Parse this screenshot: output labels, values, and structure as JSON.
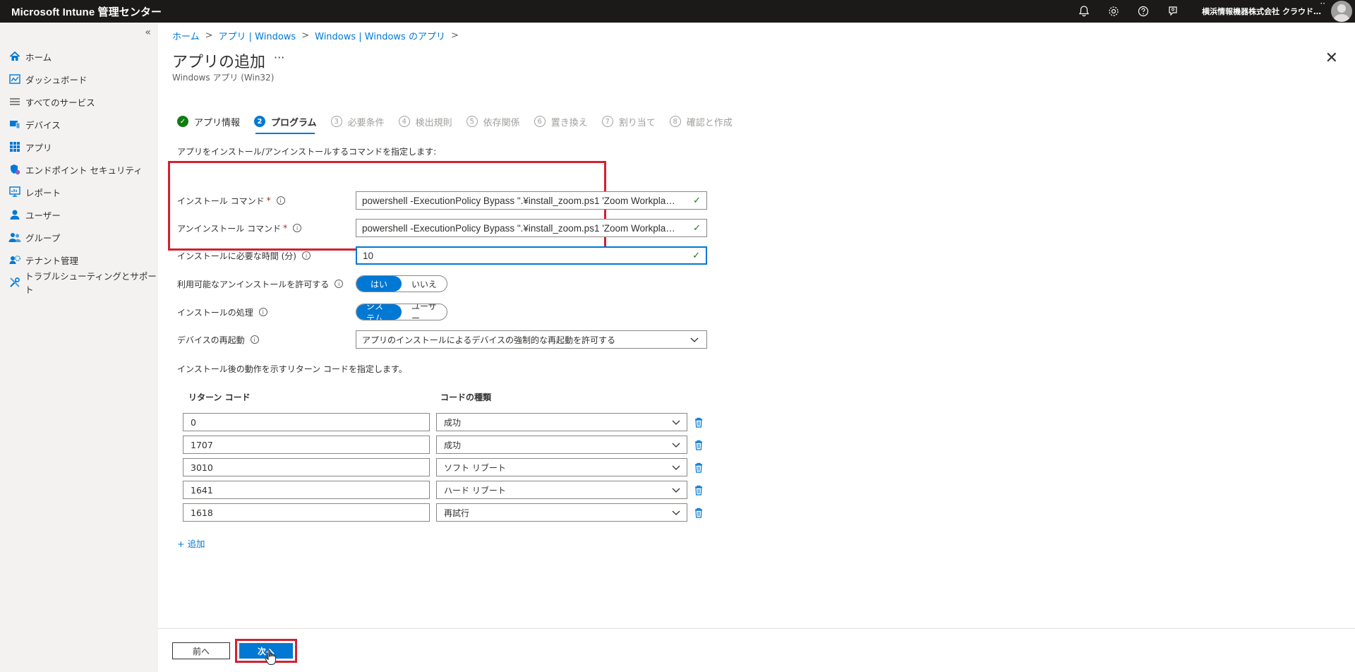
{
  "topbar": {
    "brand": "Microsoft Intune 管理センター",
    "tenant": "横浜情報機器株式会社 クラウド…",
    "dots": "··",
    "icons": [
      "bell-icon",
      "gear-icon",
      "help-icon",
      "feedback-icon"
    ]
  },
  "sidebar": {
    "collapse": "«",
    "items": [
      {
        "label": "ホーム",
        "icon": "home-icon"
      },
      {
        "label": "ダッシュボード",
        "icon": "dashboard-icon"
      },
      {
        "label": "すべてのサービス",
        "icon": "list-icon"
      },
      {
        "label": "デバイス",
        "icon": "devices-icon"
      },
      {
        "label": "アプリ",
        "icon": "apps-icon"
      },
      {
        "label": "エンドポイント セキュリティ",
        "icon": "endpoint-security-icon"
      },
      {
        "label": "レポート",
        "icon": "reports-icon"
      },
      {
        "label": "ユーザー",
        "icon": "user-icon"
      },
      {
        "label": "グループ",
        "icon": "group-icon"
      },
      {
        "label": "テナント管理",
        "icon": "tenant-admin-icon"
      },
      {
        "label": "トラブルシューティングとサポート",
        "icon": "troubleshoot-icon"
      }
    ]
  },
  "breadcrumb": [
    "ホーム",
    "アプリ | Windows",
    "Windows | Windows のアプリ"
  ],
  "breadcrumb_sep": ">",
  "page": {
    "title": "アプリの追加",
    "more": "···",
    "subtitle": "Windows アプリ (Win32)",
    "close": "✕"
  },
  "wizard": {
    "steps": [
      {
        "num": "✓",
        "label": "アプリ情報",
        "state": "done"
      },
      {
        "num": "2",
        "label": "プログラム",
        "state": "active"
      },
      {
        "num": "3",
        "label": "必要条件",
        "state": "pending"
      },
      {
        "num": "4",
        "label": "検出規則",
        "state": "pending"
      },
      {
        "num": "5",
        "label": "依存関係",
        "state": "pending"
      },
      {
        "num": "6",
        "label": "置き換え",
        "state": "pending"
      },
      {
        "num": "7",
        "label": "割り当て",
        "state": "pending"
      },
      {
        "num": "8",
        "label": "確認と作成",
        "state": "pending"
      }
    ]
  },
  "form": {
    "desc": "アプリをインストール/アンインストールするコマンドを指定します:",
    "install_cmd": {
      "label": "インストール コマンド",
      "required": "*",
      "value": "powershell -ExecutionPolicy Bypass \".¥install_zoom.ps1 'Zoom Workpla…"
    },
    "uninstall_cmd": {
      "label": "アンインストール コマンド",
      "required": "*",
      "value": "powershell -ExecutionPolicy Bypass \".¥install_zoom.ps1 'Zoom Workpla…"
    },
    "install_time": {
      "label": "インストールに必要な時間 (分)",
      "value": "10"
    },
    "allow_uninstall": {
      "label": "利用可能なアンインストールを許可する",
      "options": [
        "はい",
        "いいえ"
      ],
      "selected": "はい"
    },
    "install_behavior": {
      "label": "インストールの処理",
      "options": [
        "システム",
        "ユーザー"
      ],
      "selected": "システム"
    },
    "device_restart": {
      "label": "デバイスの再起動",
      "value": "アプリのインストールによるデバイスの強制的な再起動を許可する"
    },
    "check": "✓",
    "info": "i"
  },
  "return_codes": {
    "desc": "インストール後の動作を示すリターン コードを指定します。",
    "col_code": "リターン コード",
    "col_type": "コードの種類",
    "rows": [
      {
        "code": "0",
        "type": "成功"
      },
      {
        "code": "1707",
        "type": "成功"
      },
      {
        "code": "3010",
        "type": "ソフト リブート"
      },
      {
        "code": "1641",
        "type": "ハード リブート"
      },
      {
        "code": "1618",
        "type": "再試行"
      }
    ],
    "add": "+ 追加"
  },
  "footer": {
    "prev": "前へ",
    "next": "次へ"
  },
  "colors": {
    "accent": "#0078d4",
    "highlight": "#d32030",
    "success": "#107c10",
    "topbar": "#1b1a19"
  }
}
